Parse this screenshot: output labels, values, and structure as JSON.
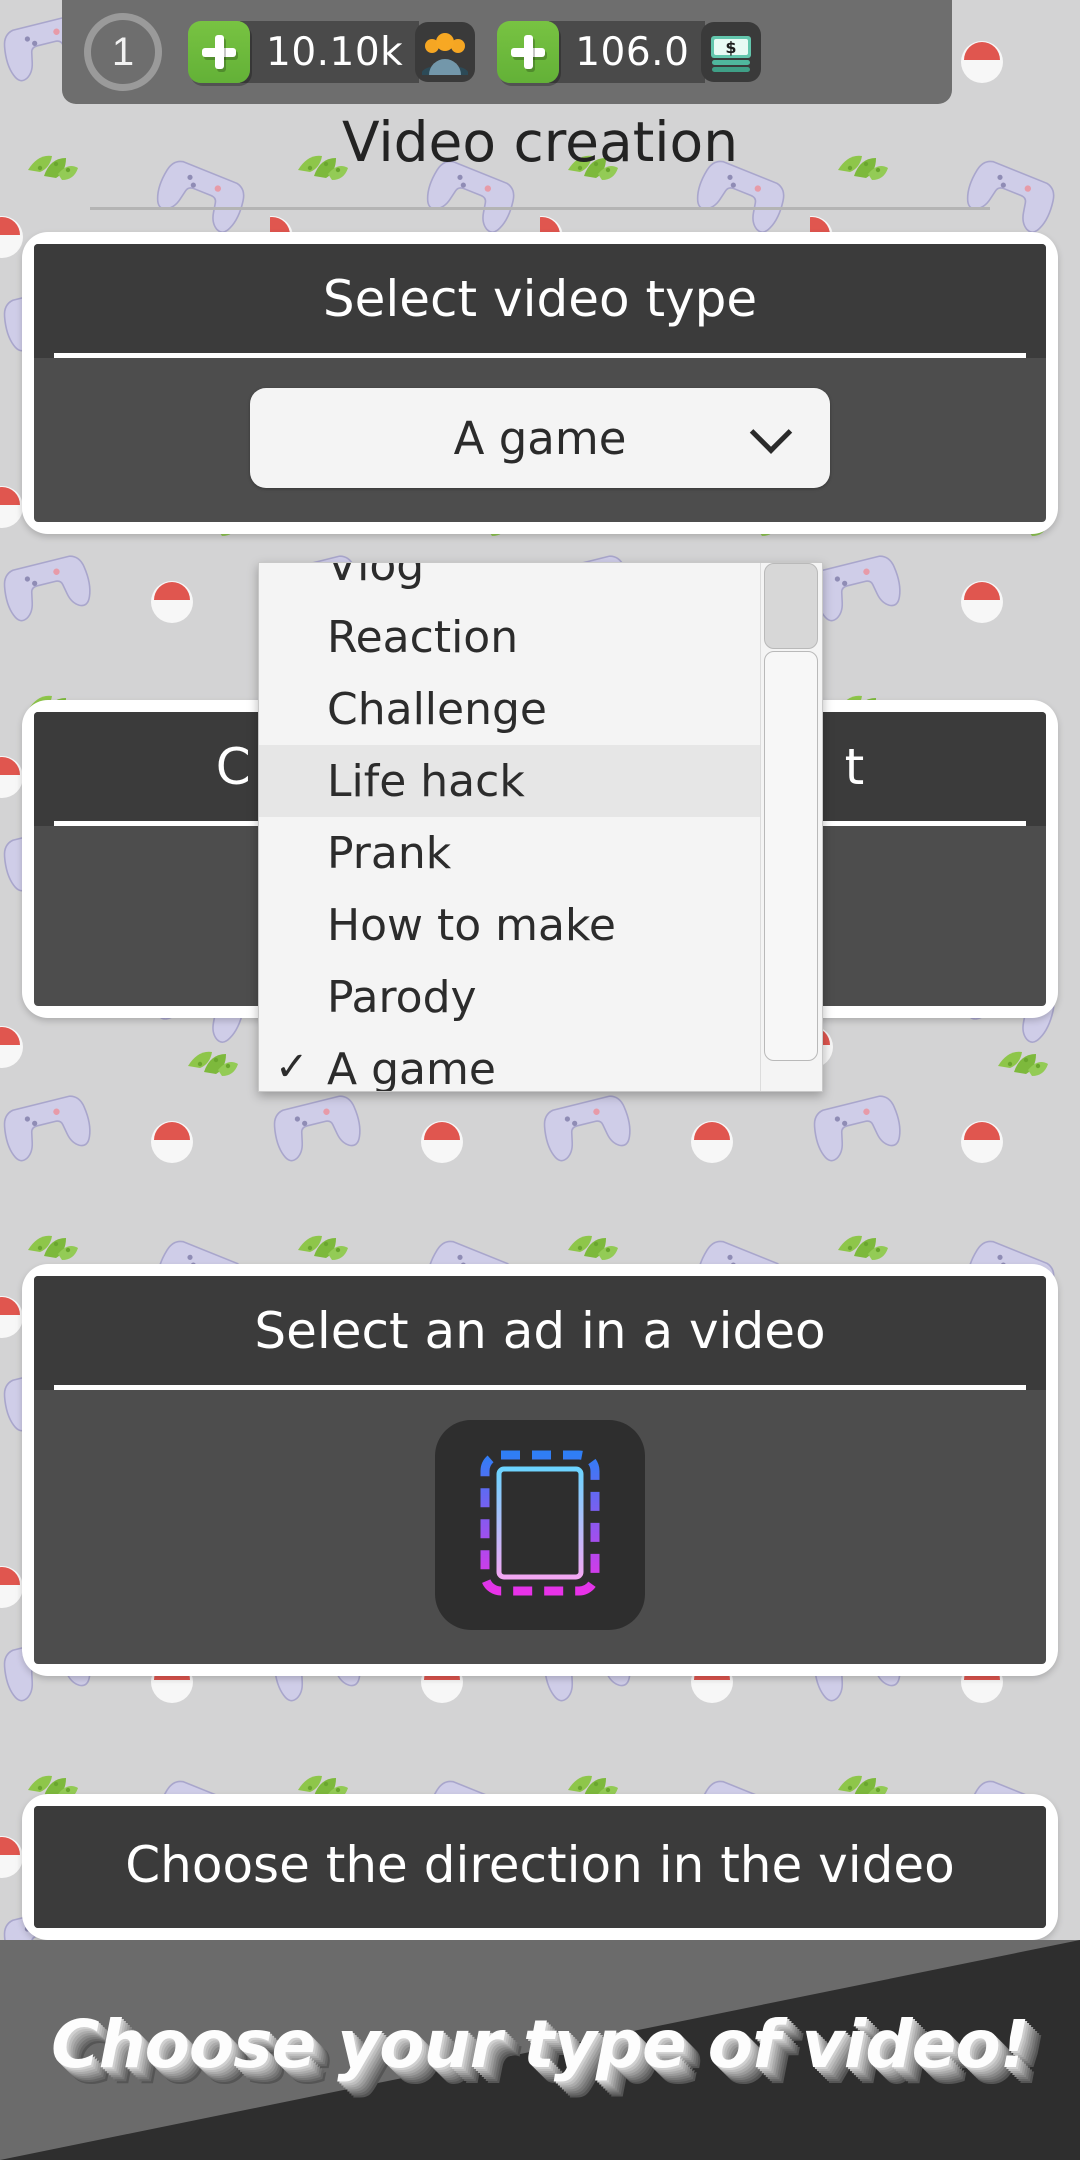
{
  "topbar": {
    "level": "1",
    "add_subs_label": "+",
    "subscribers": "10.10k",
    "subscribers_icon": "people-icon",
    "add_money_label": "+",
    "money": "106.0",
    "money_icon": "banknote-icon",
    "colors": {
      "plus_green": "#6fbd3d",
      "bar": "#6e6e6e",
      "pill": "#4a4a4a"
    }
  },
  "header": {
    "title": "Video creation"
  },
  "cards": {
    "video_type": {
      "title": "Select video type",
      "selected": "A game",
      "chevron_icon": "chevron-down-icon",
      "options": [
        {
          "label": "Vlog",
          "checked": false,
          "highlight": false
        },
        {
          "label": "Reaction",
          "checked": false,
          "highlight": false
        },
        {
          "label": "Challenge",
          "checked": false,
          "highlight": false
        },
        {
          "label": "Life hack",
          "checked": true,
          "highlight": true
        },
        {
          "label": "Prank",
          "checked": false,
          "highlight": false
        },
        {
          "label": "How to make",
          "checked": false,
          "highlight": false
        },
        {
          "label": "Parody",
          "checked": false,
          "highlight": false
        },
        {
          "label": "A game",
          "checked": true,
          "highlight": false
        }
      ],
      "check_glyph": "✓"
    },
    "hidden_card": {
      "title_left": "C",
      "title_right": "t"
    },
    "ad": {
      "title": "Select an ad in a video",
      "icon_name": "neon-ad-frame-icon",
      "icon_colors": {
        "top": "#2f7ef5",
        "bottom": "#e832e8",
        "inner_top": "#6cd4ff",
        "inner_bottom": "#f3a8f3"
      }
    },
    "direction": {
      "title": "Choose the direction in the video"
    }
  },
  "banner": {
    "text": "Choose your type of video!"
  }
}
